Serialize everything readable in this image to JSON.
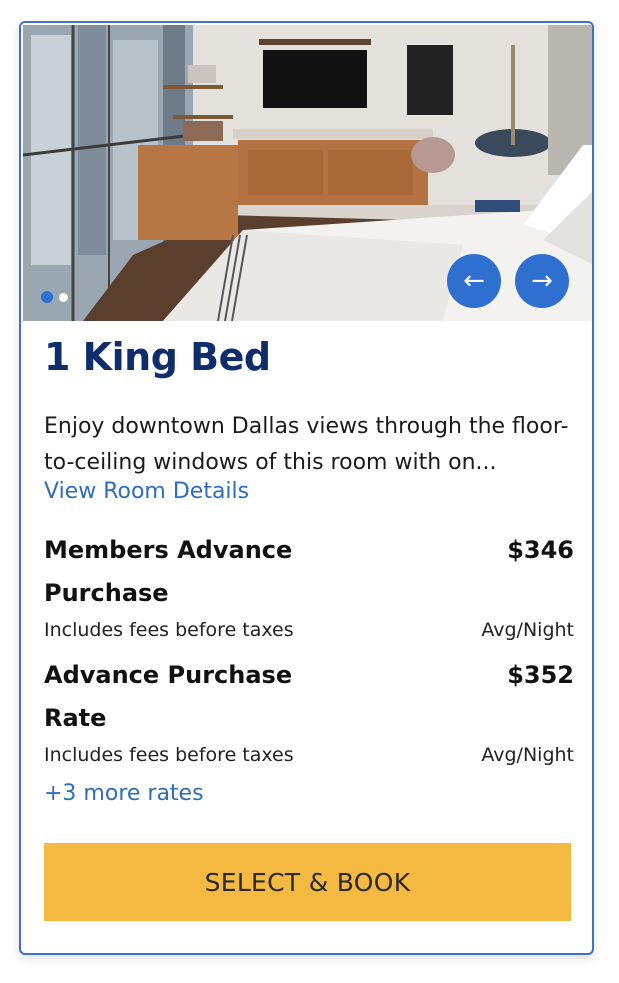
{
  "room": {
    "image_alt": "Hotel room with king bed, TV and city view windows",
    "carousel": {
      "slides": 2,
      "active": 1
    },
    "title": "1 King Bed",
    "description": "Enjoy downtown Dallas views through the floor-to-ceiling windows of this room with on...",
    "details_link": "View Room Details"
  },
  "rates": [
    {
      "name": "Members Advance Purchase",
      "price": "$346",
      "fees": "Includes fees before taxes",
      "unit": "Avg/Night"
    },
    {
      "name": "Advance Purchase Rate",
      "price": "$352",
      "fees": "Includes fees before taxes",
      "unit": "Avg/Night"
    }
  ],
  "more_rates_link": "+3 more rates",
  "nav": {
    "prev_icon": "←",
    "next_icon": "→"
  },
  "book_button": "SELECT & BOOK",
  "colors": {
    "border": "#3f74c2",
    "title": "#0f2d6b",
    "link": "#2f6db8",
    "nav_button": "#2f6fcf",
    "book_button": "#f3b941"
  }
}
